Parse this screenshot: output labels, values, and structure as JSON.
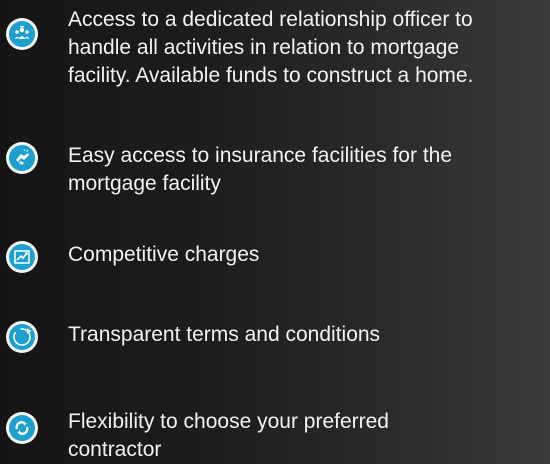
{
  "features": [
    {
      "icon": "people-group-icon",
      "lines": [
        "Access to a dedicated relationship officer to",
        "handle all activities in relation to mortgage",
        "facility. Available funds to construct a home."
      ]
    },
    {
      "icon": "handshake-icon",
      "lines": [
        "Easy access to insurance facilities for the",
        "mortgage facility"
      ]
    },
    {
      "icon": "chart-icon",
      "lines": [
        "Competitive charges"
      ]
    },
    {
      "icon": "circle-arrows-icon",
      "lines": [
        "Transparent terms and conditions"
      ]
    },
    {
      "icon": "refresh-icon",
      "lines": [
        "Flexibility to choose your preferred",
        "contractor"
      ]
    }
  ],
  "colors": {
    "icon_accent": "#1ca0cf",
    "icon_background": "#f5f5f5",
    "text": "#f2f2f2"
  }
}
